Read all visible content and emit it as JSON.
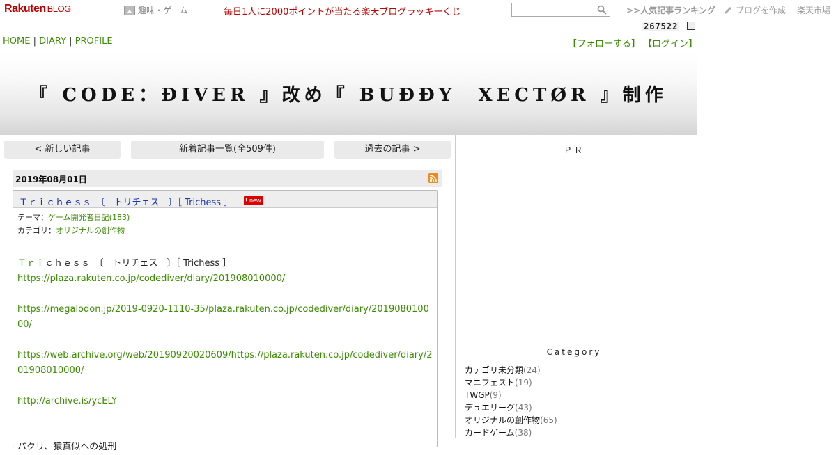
{
  "topbar": {
    "logo_main": "Rakuten",
    "logo_sub": "BLOG",
    "genre": "趣味・ゲーム",
    "lottery": "毎日1人に2000ポイントが当たる楽天ブログラッキーくじ",
    "search_placeholder": "",
    "ranking": ">>人気記事ランキング",
    "create_blog": "ブログを作成",
    "market": "楽天市場"
  },
  "counter": "267522",
  "nav": {
    "home": "HOME",
    "diary": "DIARY",
    "profile": "PROFILE",
    "sep": "|",
    "follow": "【フォローする】",
    "login": "【ログイン】"
  },
  "header": {
    "title": "『 CODE：ĐIVER 』改め『 BUĐĐY　XECTØR 』制作"
  },
  "pager": {
    "newer": "< 新しい記事",
    "list": "新着記事一覧(全509件)",
    "older": "過去の記事 >"
  },
  "entry": {
    "date": "2019年08月01日",
    "title": "Ｔｒｉｃｈｅｓｓ　〔　トリチェス　〕［ Trichess ］",
    "badge": "new",
    "theme_label": "テーマ：",
    "theme_value": "ゲーム開発者日記(183)",
    "category_label": "カテゴリ：",
    "category_value": "オリジナルの創作物",
    "line1_colored": "Ｔｒｉ",
    "line1_rest": "ｃｈｅｓｓ　〔　トリチェス　〕［ Trichess ］",
    "links": [
      "https://plaza.rakuten.co.jp/codediver/diary/201908010000/",
      "https://megalodon.jp/2019-0920-1110-35/plaza.rakuten.co.jp/codediver/diary/201908010000/",
      "https://web.archive.org/web/20190920020609/https://plaza.rakuten.co.jp/codediver/diary/201908010000/",
      "http://archive.is/ycELY"
    ],
    "last_line": "パクリ、猿真似への処刑"
  },
  "sidebar": {
    "pr_heading": "ＰＲ",
    "category_heading": "Category",
    "categories": [
      {
        "name": "カテゴリ未分類",
        "count": "(24)"
      },
      {
        "name": "マニフェスト",
        "count": "(19)"
      },
      {
        "name": "TWGP",
        "count": "(9)"
      },
      {
        "name": "デュエリーグ",
        "count": "(43)"
      },
      {
        "name": "オリジナルの創作物",
        "count": "(65)"
      },
      {
        "name": "カードゲーム",
        "count": "(38)"
      }
    ]
  },
  "colors": {
    "brand_red": "#bf0000",
    "link_green": "#3a8c00",
    "title_blue": "#1a35b0"
  }
}
